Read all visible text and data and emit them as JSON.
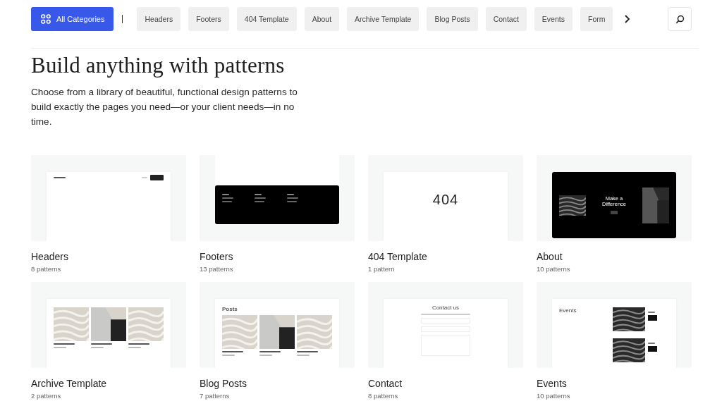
{
  "nav": {
    "all_button": {
      "label": "All Categories",
      "selected": true
    },
    "chips": [
      {
        "label": "Headers",
        "selected": false
      },
      {
        "label": "Footers",
        "selected": false
      },
      {
        "label": "404 Template",
        "selected": false
      },
      {
        "label": "About",
        "selected": false
      },
      {
        "label": "Archive Template",
        "selected": false
      },
      {
        "label": "Blog Posts",
        "selected": false
      },
      {
        "label": "Contact",
        "selected": false
      },
      {
        "label": "Events",
        "selected": false
      },
      {
        "label": "Form",
        "selected": false
      }
    ]
  },
  "hero": {
    "title": "Build anything with patterns",
    "subtitle": "Choose from a library of beautiful, functional design patterns to build exactly the pages you need—or your client needs—in no time."
  },
  "cards": [
    {
      "title": "Headers",
      "count": "8 patterns",
      "preview": {
        "kind": "header"
      }
    },
    {
      "title": "Footers",
      "count": "13 patterns",
      "preview": {
        "kind": "footer"
      }
    },
    {
      "title": "404 Template",
      "count": "1 pattern",
      "preview": {
        "kind": "notfound",
        "heading": "404"
      }
    },
    {
      "title": "About",
      "count": "10 patterns",
      "preview": {
        "kind": "about",
        "heading": "Make a Difference"
      }
    },
    {
      "title": "Archive Template",
      "count": "2 patterns",
      "preview": {
        "kind": "archive"
      }
    },
    {
      "title": "Blog Posts",
      "count": "7 patterns",
      "preview": {
        "kind": "posts",
        "heading": "Posts"
      }
    },
    {
      "title": "Contact",
      "count": "8 patterns",
      "preview": {
        "kind": "contact",
        "heading": "Contact us"
      }
    },
    {
      "title": "Events",
      "count": "10 patterns",
      "preview": {
        "kind": "events",
        "heading": "Events"
      }
    }
  ]
}
